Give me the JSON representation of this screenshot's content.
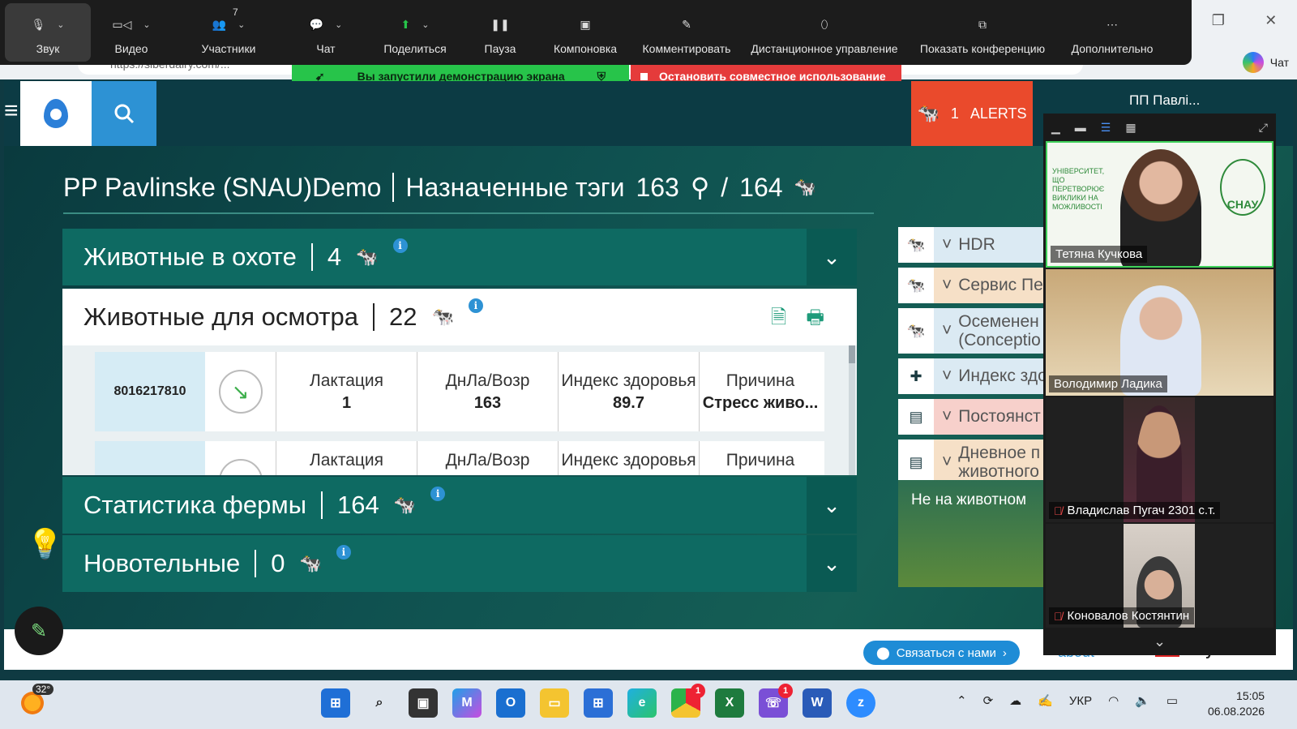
{
  "browser": {
    "url": "https://siberdairy.com/...",
    "chat_label": "Чат"
  },
  "zoom_toolbar": {
    "items": [
      {
        "label": "Звук",
        "icon": "microphone-icon"
      },
      {
        "label": "Видео",
        "icon": "video-camera-icon"
      },
      {
        "label": "Участники",
        "icon": "participants-icon",
        "count": "7"
      },
      {
        "label": "Чат",
        "icon": "chat-bubble-icon"
      },
      {
        "label": "Поделиться",
        "icon": "share-screen-icon"
      },
      {
        "label": "Пауза",
        "icon": "pause-icon"
      },
      {
        "label": "Компоновка",
        "icon": "layout-icon"
      },
      {
        "label": "Комментировать",
        "icon": "pencil-icon"
      },
      {
        "label": "Дистанционное управление",
        "icon": "mouse-icon"
      },
      {
        "label": "Показать конференцию",
        "icon": "show-meeting-icon"
      },
      {
        "label": "Дополнительно",
        "icon": "more-icon"
      }
    ],
    "caret": "⌄"
  },
  "sharing": {
    "status": "Вы запустили демонстрацию экрана",
    "stop": "Остановить совместное использование"
  },
  "header": {
    "alerts_count": "1",
    "alerts_label": "ALERTS",
    "farm_short": "ПП Павлі..."
  },
  "page": {
    "farm_name": "PP Pavlinske (SNAU)Demo",
    "subtitle": "Назначенные тэги",
    "tags_assigned": "163",
    "slash": "/",
    "total_animals": "164"
  },
  "panels": {
    "heat": {
      "title": "Животные в охоте",
      "count": "4"
    },
    "check": {
      "title": "Животные для осмотра",
      "count": "22"
    },
    "farm_stats": {
      "title": "Статистика фермы",
      "count": "164"
    },
    "fresh": {
      "title": "Новотельные",
      "count": "0"
    }
  },
  "check_rows": [
    {
      "tag": "8016217810",
      "lactation_label": "Лактация",
      "lactation": "1",
      "dim_label": "ДнЛа/Возр",
      "dim": "163",
      "health_label": "Индекс здоровья",
      "health": "89.7",
      "reason_label": "Причина",
      "reason": "Стресс живо..."
    },
    {
      "tag": "",
      "lactation_label": "Лактация",
      "lactation": "",
      "dim_label": "ДнЛа/Возр",
      "dim": "",
      "health_label": "Индекс здоровья",
      "health": "",
      "reason_label": "Причина",
      "reason": ""
    }
  ],
  "right_list": [
    {
      "label": "HDR",
      "color": "#dbeaf3"
    },
    {
      "label": "Сервис Пе",
      "color": "#f6e0c7"
    },
    {
      "label": "Осеменен (Conceptio",
      "color": "#dbeaf3"
    },
    {
      "label": "Индекс здо",
      "color": "#dbeaf3"
    },
    {
      "label": "Постоянст",
      "color": "#f7d0cb"
    },
    {
      "label": "Дневное п животного",
      "color": "#f6e0c7"
    }
  ],
  "not_on_farm": "Не на животном",
  "footer": {
    "contact": "Связаться с нами",
    "about": "about",
    "language": "Русский"
  },
  "gallery": {
    "participants": [
      {
        "name": "Тетяна Кучкова",
        "muted": false
      },
      {
        "name": "Володимир Ладика",
        "muted": false
      },
      {
        "name": "Владислав Пугач 2301 с.т.",
        "muted": true
      },
      {
        "name": "Коновалов Костянтин",
        "muted": true
      }
    ],
    "uni_text": "УНІВЕРСИТЕТ, ЩО ПЕРЕТВОРЮЄ ВИКЛИКИ НА МОЖЛИВОСТІ",
    "uni_logo": "СНАУ"
  },
  "taskbar": {
    "temperature": "32°",
    "language": "УКР",
    "time": "15:05",
    "date": "06.08.2026",
    "badges": {
      "chrome": "1",
      "viber": "1"
    }
  }
}
